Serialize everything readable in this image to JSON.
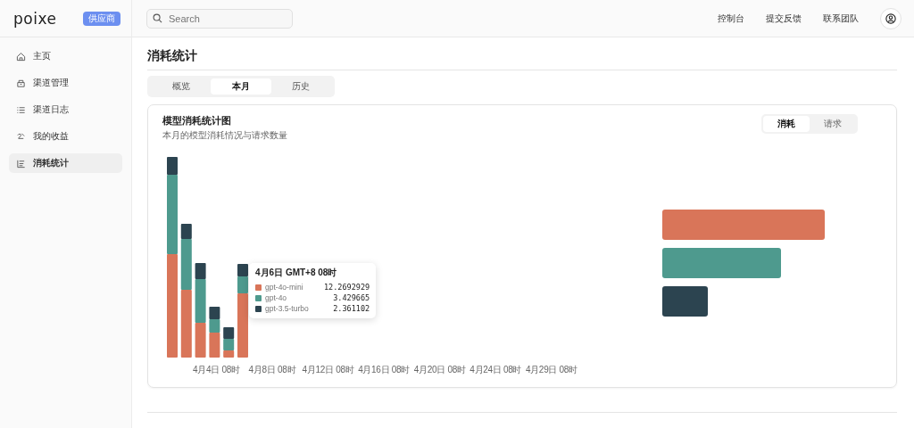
{
  "brand": {
    "logo": "poixe",
    "badge": "供应商"
  },
  "search": {
    "placeholder": "Search"
  },
  "top_links": [
    "控制台",
    "提交反馈",
    "联系团队"
  ],
  "sidebar": {
    "items": [
      {
        "label": "主页",
        "selected": false
      },
      {
        "label": "渠道管理",
        "selected": false
      },
      {
        "label": "渠道日志",
        "selected": false
      },
      {
        "label": "我的收益",
        "selected": false
      },
      {
        "label": "消耗统计",
        "selected": true
      }
    ]
  },
  "page_title": "消耗统计",
  "tabs": [
    {
      "label": "概览",
      "selected": false
    },
    {
      "label": "本月",
      "selected": true
    },
    {
      "label": "历史",
      "selected": false
    }
  ],
  "card": {
    "title": "模型消耗统计图",
    "subtitle": "本月的模型消耗情况与请求数量",
    "toggle": [
      {
        "label": "消耗",
        "selected": true
      },
      {
        "label": "请求",
        "selected": false
      }
    ],
    "x_labels": [
      "4月4日 08时",
      "4月8日 08时",
      "4月12日 08时",
      "4月16日 08时",
      "4月20日 08时",
      "4月24日 08时",
      "4月29日 08时"
    ],
    "tooltip": {
      "title": "4月6日 GMT+8 08时",
      "rows": [
        {
          "name": "gpt-4o-mini",
          "value": "12.2692929",
          "color": "#d97559"
        },
        {
          "name": "gpt-4o",
          "value": "3.429665",
          "color": "#4e9a8e"
        },
        {
          "name": "gpt-3.5-turbo",
          "value": "2.361102",
          "color": "#2c4450"
        }
      ]
    }
  }
}
